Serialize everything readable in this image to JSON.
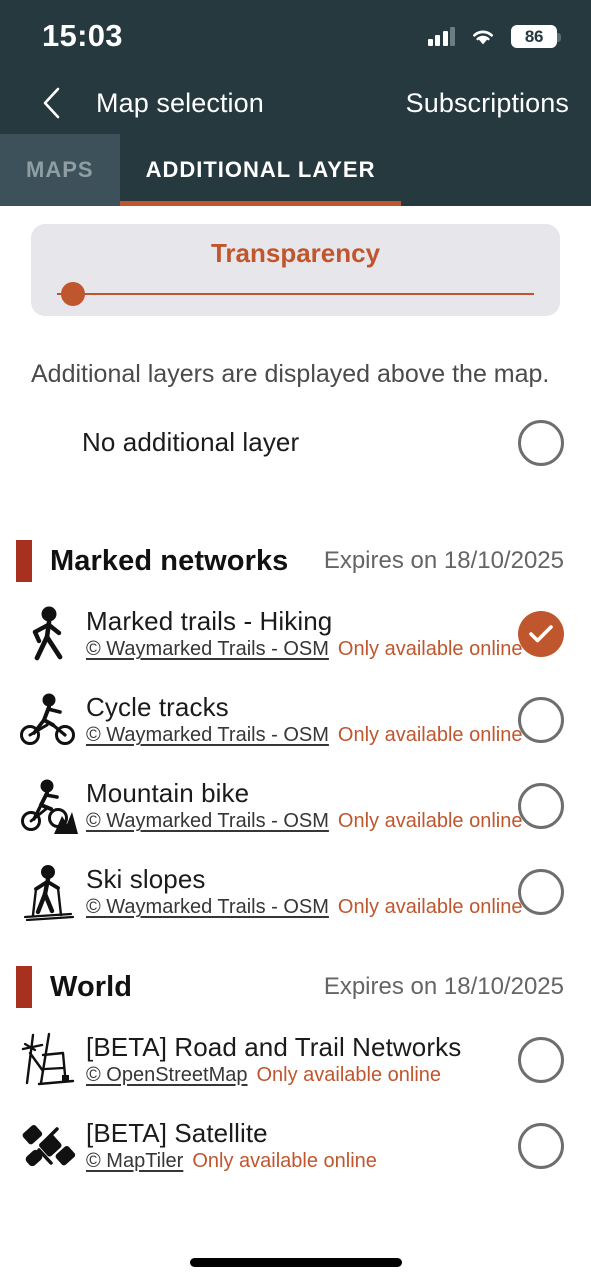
{
  "statusbar": {
    "time": "15:03",
    "battery_level": "86",
    "signal_icon": "cellular-signal-icon",
    "wifi_icon": "wifi-icon",
    "battery_icon": "battery-icon"
  },
  "navbar": {
    "back_icon": "back-chevron-icon",
    "title": "Map selection",
    "action_label": "Subscriptions"
  },
  "tabs": [
    {
      "label": "MAPS",
      "active": false
    },
    {
      "label": "ADDITIONAL LAYER",
      "active": true
    }
  ],
  "transparency": {
    "title": "Transparency",
    "value": 0
  },
  "hint": "Additional layers are displayed above the map.",
  "no_layer_row": {
    "title": "No additional layer",
    "selected": false
  },
  "sections": [
    {
      "title": "Marked networks",
      "expiry": "Expires on 18/10/2025",
      "items": [
        {
          "icon": "hiker-icon",
          "title": "Marked trails - Hiking",
          "attribution": "© Waymarked Trails - OSM",
          "availability": "Only available online",
          "selected": true
        },
        {
          "icon": "cyclist-icon",
          "title": "Cycle tracks",
          "attribution": "© Waymarked Trails - OSM",
          "availability": "Only available online",
          "selected": false
        },
        {
          "icon": "mountain-biker-icon",
          "title": "Mountain bike",
          "attribution": "© Waymarked Trails - OSM",
          "availability": "Only available online",
          "selected": false
        },
        {
          "icon": "skier-icon",
          "title": "Ski slopes",
          "attribution": "© Waymarked Trails - OSM",
          "availability": "Only available online",
          "selected": false
        }
      ]
    },
    {
      "title": "World",
      "expiry": "Expires on 18/10/2025",
      "items": [
        {
          "icon": "road-network-icon",
          "title": "[BETA] Road and Trail Networks",
          "attribution": "© OpenStreetMap",
          "availability": "Only available online",
          "selected": false
        },
        {
          "icon": "satellite-icon",
          "title": "[BETA] Satellite",
          "attribution": "© MapTiler",
          "availability": "Only available online",
          "selected": false
        }
      ]
    }
  ],
  "colors": {
    "header_bg": "#25393f",
    "accent_orange": "#c0562e",
    "section_marker_red": "#a8301f",
    "card_bg": "#e7e6ea",
    "tab_inactive_bg": "#3c5159"
  }
}
